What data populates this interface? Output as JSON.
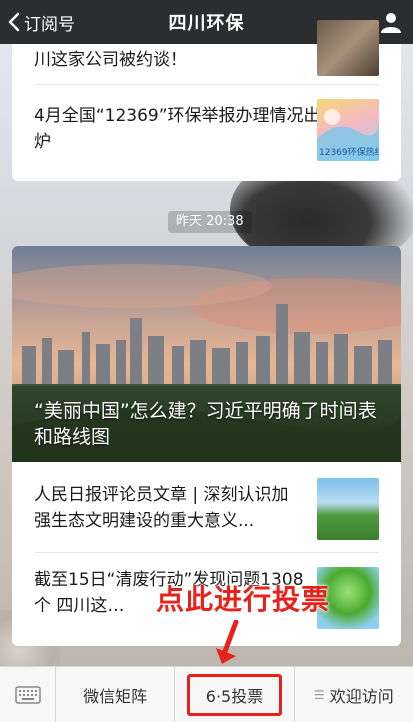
{
  "header": {
    "back_label": "订阅号",
    "title": "四川环保",
    "user_icon": "person-icon"
  },
  "card1": {
    "items": [
      {
        "title": "川这家公司被约谈！"
      },
      {
        "title": "4月全国“12369”环保举报办理情况出炉",
        "thumb_caption": "12369环保热线"
      }
    ]
  },
  "timestamp": "昨天 20:38",
  "card2": {
    "hero_title": "“美丽中国”怎么建？习近平明确了时间表和路线图",
    "items": [
      {
        "title": "人民日报评论员文章 | 深刻认识加强生态文明建设的重大意义..."
      },
      {
        "title": "截至15日“清废行动”发现问题1308个  四川这…"
      }
    ]
  },
  "annotation": {
    "text": "点此进行投票",
    "color": "#e8221b"
  },
  "bottom_bar": {
    "keyboard_icon": "keyboard-icon",
    "items": [
      {
        "label": "微信矩阵"
      },
      {
        "label": "6·5投票"
      },
      {
        "label": "欢迎访问"
      }
    ]
  }
}
